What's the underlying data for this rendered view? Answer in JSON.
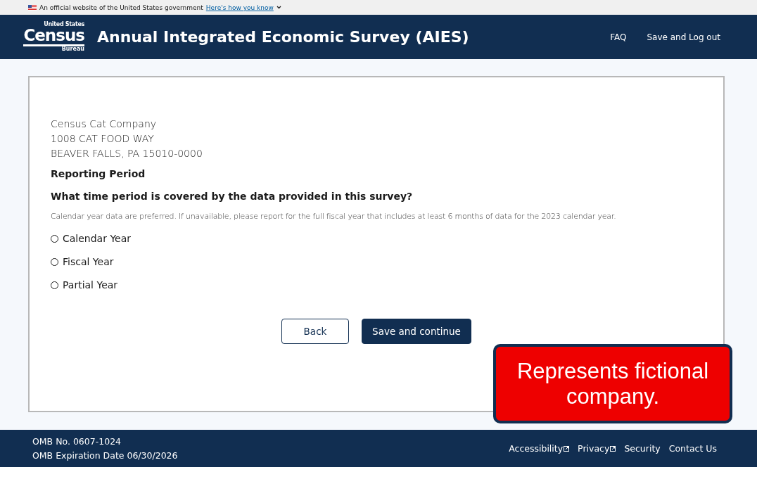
{
  "gov_banner": {
    "text": "An official website of the United States government",
    "link": "Here's how you know"
  },
  "header": {
    "logo": {
      "top": "United States",
      "main": "Census",
      "bottom": "Bureau"
    },
    "title": "Annual Integrated Economic Survey (AIES)",
    "links": [
      "FAQ",
      "Save and Log out"
    ]
  },
  "company": {
    "lines": [
      "Census Cat Company",
      "1008 CAT FOOD WAY",
      "BEAVER FALLS, PA 15010-0000"
    ]
  },
  "section_title": "Reporting Period",
  "question": "What time period is covered by the data provided in this survey?",
  "hint": "Calendar year data are preferred. If unavailable, please report for the full fiscal year that includes at least 6 months of data for the 2023 calendar year.",
  "options": [
    {
      "label": "Calendar Year",
      "selected": false
    },
    {
      "label": "Fiscal Year",
      "selected": false
    },
    {
      "label": "Partial Year",
      "selected": false
    }
  ],
  "buttons": [
    {
      "label": "Back",
      "kind": "secondary"
    },
    {
      "label": "Save and continue",
      "kind": "primary"
    }
  ],
  "callout": "Represents fictional company.",
  "footer": {
    "omb": [
      "OMB No. 0607-1024",
      "OMB Expiration Date 06/30/2026"
    ],
    "links": [
      {
        "label": "Accessibility",
        "external": true
      },
      {
        "label": "Privacy",
        "external": true
      },
      {
        "label": "Security",
        "external": false
      },
      {
        "label": "Contact Us",
        "external": false
      }
    ]
  }
}
